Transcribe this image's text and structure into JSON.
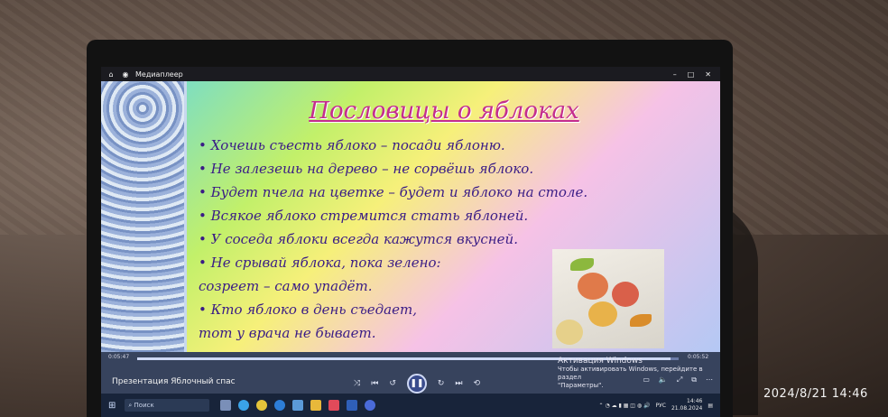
{
  "window": {
    "title": "Медиаплеер"
  },
  "slide": {
    "title": "Пословицы о яблоках",
    "proverbs": [
      "• Хочешь съесть яблоко – посади яблоню.",
      "• Не залезешь на дерево – не сорвёшь яблоко.",
      "• Будет пчела на цветке – будет и яблоко на столе.",
      "• Всякое яблоко стремится стать яблоней.",
      "• У соседа яблоки всегда кажутся вкусней.",
      "• Не срывай яблока, пока зелено:",
      "созреет – само упадёт.",
      "• Кто яблоко в день съедает,",
      "тот у врача не бывает."
    ]
  },
  "player": {
    "elapsed": "0:05:47",
    "duration": "0:05:52",
    "progress_fraction": 0.985,
    "media_title": "Презентация Яблочный спас"
  },
  "activation": {
    "heading": "Активация Windows",
    "line1": "Чтобы активировать Windows, перейдите в раздел",
    "line2": "\"Параметры\"."
  },
  "taskbar": {
    "search_placeholder": "Поиск",
    "lang": "РУС",
    "time": "14:46",
    "date": "21.08.2024"
  },
  "photo_timestamp": "2024/8/21 14:46",
  "colors": {
    "title": "#c42d8e",
    "text": "#3a1c86",
    "taskbar": "#18243a"
  }
}
